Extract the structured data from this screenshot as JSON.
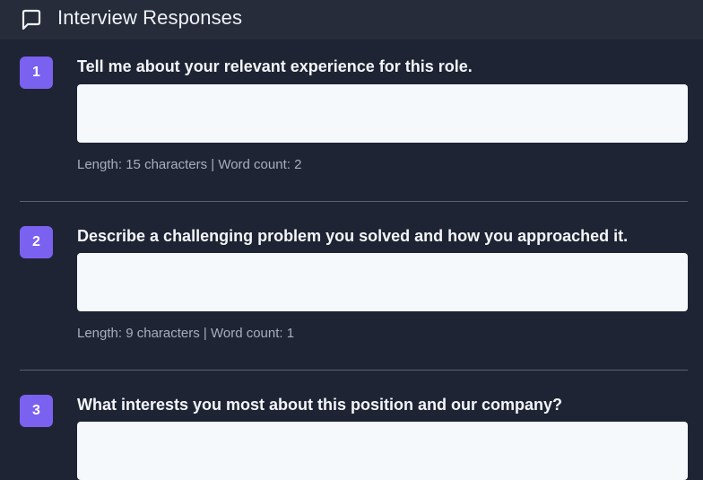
{
  "header": {
    "title": "Interview Responses",
    "icon": "chat-bubble-icon"
  },
  "questions": [
    {
      "number": "1",
      "text": "Tell me about your relevant experience for this role.",
      "answer": "",
      "meta": "Length: 15 characters | Word count: 2"
    },
    {
      "number": "2",
      "text": "Describe a challenging problem you solved and how you approached it.",
      "answer": "",
      "meta": "Length: 9 characters | Word count: 1"
    },
    {
      "number": "3",
      "text": "What interests you most about this position and our company?",
      "answer": ""
    }
  ],
  "colors": {
    "background": "#1e2433",
    "header_background": "#262c3a",
    "accent": "#7b61f0",
    "answer_background": "#f6f9fc",
    "meta_text": "#a7aebc"
  }
}
